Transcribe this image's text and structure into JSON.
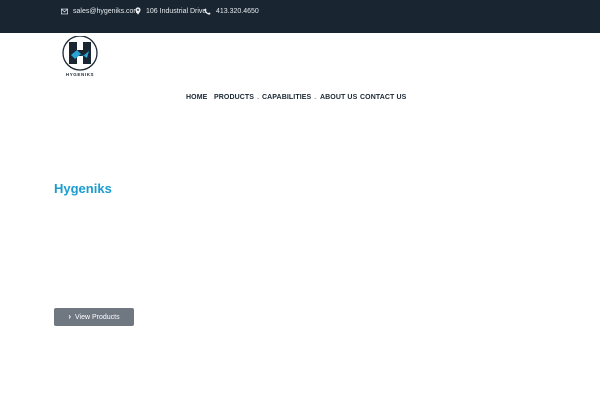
{
  "topbar": {
    "email": "sales@hygeniks.com",
    "address": "106 Industrial Drive",
    "phone": "413.320.4650"
  },
  "logo": {
    "wordmark": "HYGENIKS"
  },
  "nav": {
    "items": [
      {
        "label": "HOME",
        "has_dropdown": false
      },
      {
        "label": "PRODUCTS",
        "has_dropdown": true
      },
      {
        "label": "CAPABILITIES",
        "has_dropdown": true
      },
      {
        "label": "ABOUT US",
        "has_dropdown": false
      },
      {
        "label": "CONTACT US",
        "has_dropdown": false
      }
    ]
  },
  "hero": {
    "title": "Hygeniks",
    "button_label": "View Products"
  },
  "colors": {
    "topbar_bg": "#192530",
    "accent": "#1b9bcf",
    "button_bg": "#6f7780"
  }
}
